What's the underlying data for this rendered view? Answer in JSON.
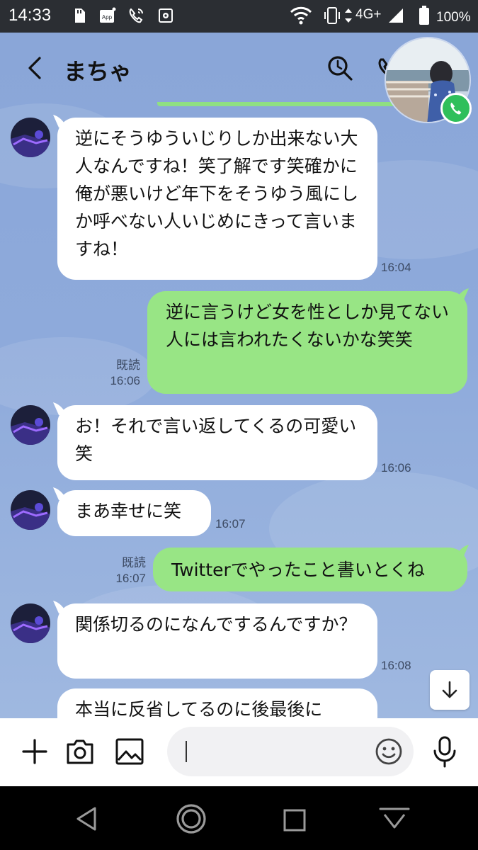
{
  "status_bar": {
    "time": "14:33",
    "network": "4G+",
    "battery": "100%",
    "icons": [
      "sd-card-icon",
      "app-notification-icon",
      "wifi-calling-icon",
      "settings-notification-icon",
      "wifi-icon",
      "vibrate-icon",
      "data-arrows-icon",
      "signal-icon",
      "battery-icon"
    ]
  },
  "header": {
    "title": "まちゃ",
    "icons": [
      "back-icon",
      "search-icon",
      "phone-icon"
    ]
  },
  "messages": [
    {
      "side": "in",
      "text": "逆にそうゆういじりしか出来ない大人なんですね！笑了解です笑確かに俺が悪いけど年下をそうゆう風にしか呼べない人いじめにきって言いますね！",
      "time": "16:04"
    },
    {
      "side": "out",
      "text": "逆に言うけど女を性としか見てない人には言われたくないかな笑笑",
      "read": "既読",
      "time": "16:06"
    },
    {
      "side": "in",
      "text": "お！それで言い返してくるの可愛い笑",
      "time": "16:06"
    },
    {
      "side": "in",
      "text": "まあ幸せに笑",
      "time": "16:07"
    },
    {
      "side": "out",
      "text": "Twitterでやったこと書いとくね",
      "read": "既読",
      "time": "16:07"
    },
    {
      "side": "in",
      "text": "関係切るのになんでするんですか？",
      "time": "16:08"
    },
    {
      "side": "in",
      "text": "本当に反省してるのに後最後に",
      "time": ""
    }
  ],
  "input_bar": {
    "icons": [
      "plus-icon",
      "camera-icon",
      "image-icon",
      "emoji-icon",
      "microphone-icon"
    ],
    "placeholder": ""
  },
  "nav_bar": {
    "icons": [
      "nav-back-icon",
      "nav-home-icon",
      "nav-recents-icon",
      "nav-keyboard-hide-icon"
    ]
  },
  "colors": {
    "chat_background": "#8aa6d8",
    "incoming_bubble": "#ffffff",
    "outgoing_bubble": "#98e585",
    "status_bar": "#2b2e33",
    "call_green": "#2fbf5b"
  }
}
